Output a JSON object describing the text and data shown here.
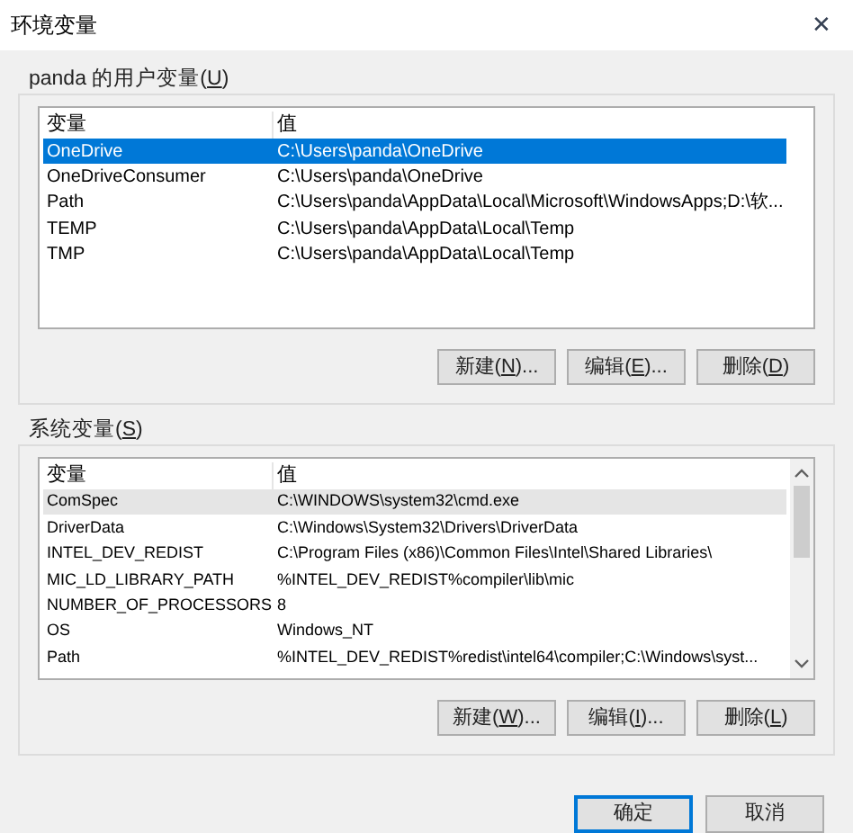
{
  "window": {
    "title": "环境变量",
    "close": "✕"
  },
  "user_vars": {
    "label": {
      "before": "panda 的用户变量(",
      "key": "U",
      "after": ")"
    },
    "columns": [
      "变量",
      "值"
    ],
    "rows": [
      {
        "name": "OneDrive",
        "value": "C:\\Users\\panda\\OneDrive",
        "selected": true
      },
      {
        "name": "OneDriveConsumer",
        "value": "C:\\Users\\panda\\OneDrive",
        "selected": false
      },
      {
        "name": "Path",
        "value": "C:\\Users\\panda\\AppData\\Local\\Microsoft\\WindowsApps;D:\\软...",
        "selected": false
      },
      {
        "name": "TEMP",
        "value": "C:\\Users\\panda\\AppData\\Local\\Temp",
        "selected": false
      },
      {
        "name": "TMP",
        "value": "C:\\Users\\panda\\AppData\\Local\\Temp",
        "selected": false
      }
    ],
    "buttons": [
      {
        "before": "新建(",
        "key": "N",
        "after": ")..."
      },
      {
        "before": "编辑(",
        "key": "E",
        "after": ")..."
      },
      {
        "before": "删除(",
        "key": "D",
        "after": ")"
      }
    ]
  },
  "system_vars": {
    "label": {
      "before": "系统变量(",
      "key": "S",
      "after": ")"
    },
    "columns": [
      "变量",
      "值"
    ],
    "rows": [
      {
        "name": "ComSpec",
        "value": "C:\\WINDOWS\\system32\\cmd.exe",
        "selected": false,
        "hovered": true
      },
      {
        "name": "DriverData",
        "value": "C:\\Windows\\System32\\Drivers\\DriverData",
        "selected": false,
        "hovered": false
      },
      {
        "name": "INTEL_DEV_REDIST",
        "value": "C:\\Program Files (x86)\\Common Files\\Intel\\Shared Libraries\\",
        "selected": false,
        "hovered": false
      },
      {
        "name": "MIC_LD_LIBRARY_PATH",
        "value": "%INTEL_DEV_REDIST%compiler\\lib\\mic",
        "selected": false,
        "hovered": false
      },
      {
        "name": "NUMBER_OF_PROCESSORS",
        "value": "8",
        "selected": false,
        "hovered": false
      },
      {
        "name": "OS",
        "value": "Windows_NT",
        "selected": false,
        "hovered": false
      },
      {
        "name": "Path",
        "value": "%INTEL_DEV_REDIST%redist\\intel64\\compiler;C:\\Windows\\syst...",
        "selected": false,
        "hovered": false
      }
    ],
    "buttons": [
      {
        "before": "新建(",
        "key": "W",
        "after": ")..."
      },
      {
        "before": "编辑(",
        "key": "I",
        "after": ")..."
      },
      {
        "before": "删除(",
        "key": "L",
        "after": ")"
      }
    ]
  },
  "dialog_buttons": [
    {
      "label": "确定",
      "default": true
    },
    {
      "label": "取消",
      "default": false
    }
  ]
}
